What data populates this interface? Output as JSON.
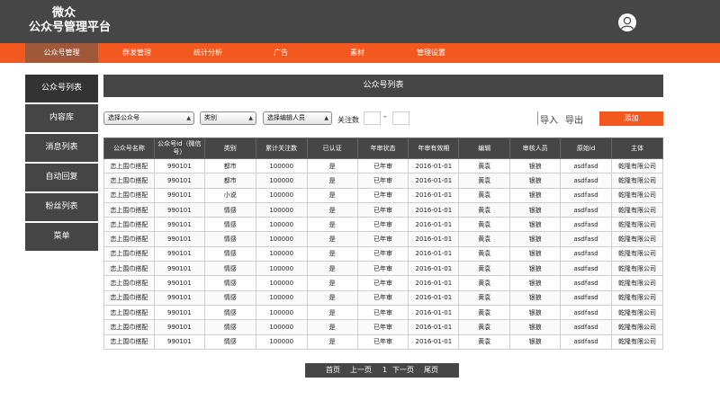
{
  "header": {
    "brand_line1": "微众",
    "brand_line2": "公众号管理平台",
    "avatar_icon": "user-avatar-icon"
  },
  "nav": {
    "items": [
      "公众号管理",
      "群发管理",
      "统计分析",
      "广告",
      "素材",
      "管理设置"
    ],
    "active_index": 0
  },
  "sidebar": {
    "items": [
      "公众号列表",
      "内容库",
      "消息列表",
      "自动回复",
      "粉丝列表",
      "菜单"
    ],
    "active_index": 0
  },
  "main": {
    "title": "公众号列表"
  },
  "filters": {
    "account_select": "选择公众号",
    "category_select": "类别",
    "editor_select": "选择编辑人员",
    "follow_label": "关注数",
    "range_dash": "-",
    "import_label": "导入",
    "export_label": "导出",
    "add_label": "添加"
  },
  "table": {
    "headers": [
      "公众号名称",
      "公众号id（微信号）",
      "类别",
      "累计关注数",
      "已认证",
      "年审状态",
      "年审有效期",
      "编辑",
      "审核人员",
      "原始id",
      "主体"
    ],
    "rows": [
      [
        "恋上围巾搭配",
        "990101",
        "都市",
        "100000",
        "是",
        "已年审",
        "2016-01-01",
        "黄袁",
        "银狼",
        "asdfasd",
        "乾隆有限公司"
      ],
      [
        "恋上围巾搭配",
        "990101",
        "都市",
        "100000",
        "是",
        "已年审",
        "2016-01-01",
        "黄袁",
        "银狼",
        "asdfasd",
        "乾隆有限公司"
      ],
      [
        "恋上围巾搭配",
        "990101",
        "小说",
        "100000",
        "是",
        "已年审",
        "2016-01-01",
        "黄袁",
        "银狼",
        "asdfasd",
        "乾隆有限公司"
      ],
      [
        "恋上围巾搭配",
        "990101",
        "情感",
        "100000",
        "是",
        "已年审",
        "2016-01-01",
        "黄袁",
        "银狼",
        "asdfasd",
        "乾隆有限公司"
      ],
      [
        "恋上围巾搭配",
        "990101",
        "情感",
        "100000",
        "是",
        "已年审",
        "2016-01-01",
        "黄袁",
        "银狼",
        "asdfasd",
        "乾隆有限公司"
      ],
      [
        "恋上围巾搭配",
        "990101",
        "情感",
        "100000",
        "是",
        "已年审",
        "2016-01-01",
        "黄袁",
        "银狼",
        "asdfasd",
        "乾隆有限公司"
      ],
      [
        "恋上围巾搭配",
        "990101",
        "情感",
        "100000",
        "是",
        "已年审",
        "2016-01-01",
        "黄袁",
        "银狼",
        "asdfasd",
        "乾隆有限公司"
      ],
      [
        "恋上围巾搭配",
        "990101",
        "情感",
        "100000",
        "是",
        "已年审",
        "2016-01-01",
        "黄袁",
        "银狼",
        "asdfasd",
        "乾隆有限公司"
      ],
      [
        "恋上围巾搭配",
        "990101",
        "情感",
        "100000",
        "是",
        "已年审",
        "2016-01-01",
        "黄袁",
        "银狼",
        "asdfasd",
        "乾隆有限公司"
      ],
      [
        "恋上围巾搭配",
        "990101",
        "情感",
        "100000",
        "是",
        "已年审",
        "2016-01-01",
        "黄袁",
        "银狼",
        "asdfasd",
        "乾隆有限公司"
      ],
      [
        "恋上围巾搭配",
        "990101",
        "情感",
        "100000",
        "是",
        "已年审",
        "2016-01-01",
        "黄袁",
        "银狼",
        "asdfasd",
        "乾隆有限公司"
      ],
      [
        "恋上围巾搭配",
        "990101",
        "情感",
        "100000",
        "是",
        "已年审",
        "2016-01-01",
        "黄袁",
        "银狼",
        "asdfasd",
        "乾隆有限公司"
      ],
      [
        "恋上围巾搭配",
        "990101",
        "情感",
        "100000",
        "是",
        "已年审",
        "2016-01-01",
        "黄袁",
        "银狼",
        "asdfasd",
        "乾隆有限公司"
      ]
    ]
  },
  "pager": {
    "first": "首页",
    "prev": "上一页",
    "current": "1",
    "next": "下一页",
    "last": "尾页"
  },
  "colors": {
    "header_bg": "#464646",
    "accent": "#f3581f",
    "nav_active": "#a0583a"
  }
}
